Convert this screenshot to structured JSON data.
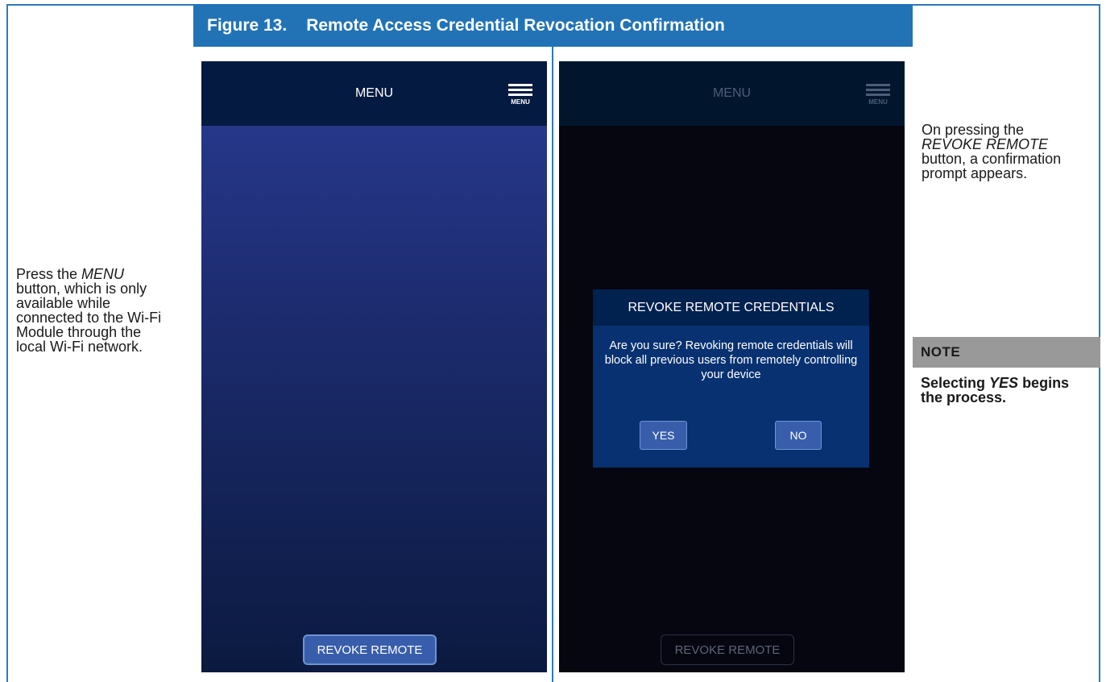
{
  "figure": {
    "number": "Figure 13.",
    "title": "Remote Access Credential Revocation Confirmation"
  },
  "left_instruction": {
    "pre": "Press the ",
    "emph": "MENU",
    "post": " button, which is only available while connected to the Wi-Fi Module through the local Wi-Fi network."
  },
  "right_instruction": {
    "pre": "On pressing the ",
    "emph": "REVOKE REMOTE",
    "post": " button, a confirmation prompt appears."
  },
  "note": {
    "heading": "NOTE",
    "pre": "Selecting ",
    "emph": "YES",
    "post": " begins the process."
  },
  "screen_left": {
    "title": "MENU",
    "menu_icon_label": "MENU",
    "revoke_button": "REVOKE REMOTE"
  },
  "screen_right": {
    "title": "MENU",
    "menu_icon_label": "MENU",
    "revoke_button": "REVOKE REMOTE",
    "dialog": {
      "title": "REVOKE REMOTE CREDENTIALS",
      "message": "Are you sure? Revoking remote credentials will block all previous users from remotely controlling your device",
      "yes": "YES",
      "no": "NO"
    }
  },
  "colors": {
    "figure_header": "#2273b5",
    "button": "#385eab",
    "note_header": "#999999"
  }
}
